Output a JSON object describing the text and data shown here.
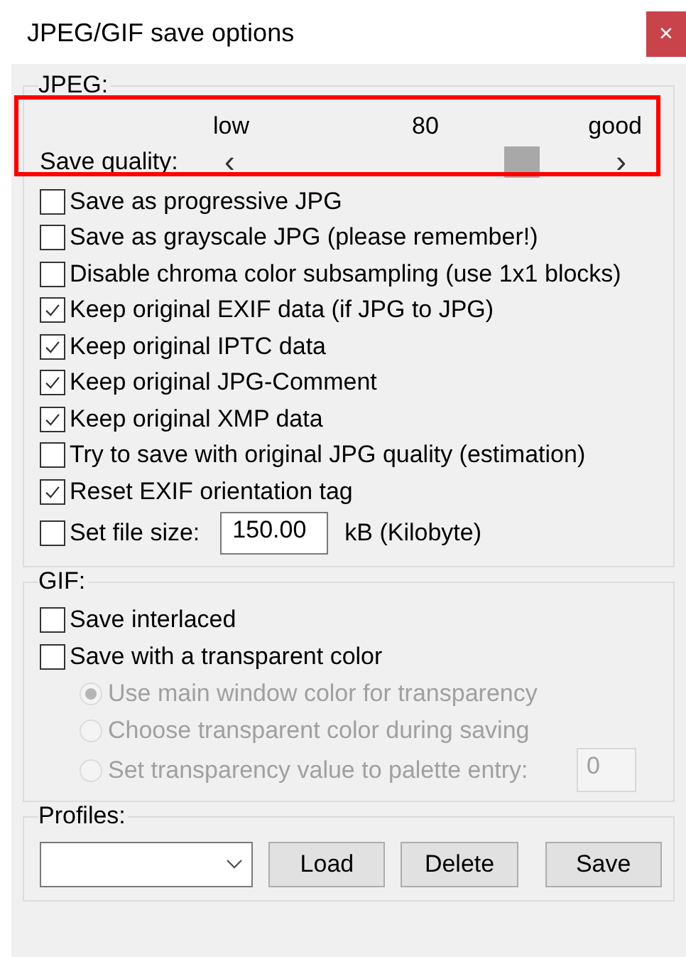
{
  "window": {
    "title": "JPEG/GIF save options",
    "close": "×"
  },
  "jpeg": {
    "title": "JPEG:",
    "highlighted": true,
    "quality": {
      "label": "Save quality:",
      "min_label": "low",
      "value": "80",
      "max_label": "good",
      "level": 0.8,
      "prev": "‹",
      "next": "›"
    },
    "options": [
      {
        "kind": "checkbox",
        "label": "Save as progressive JPG",
        "checked": false
      },
      {
        "kind": "checkbox",
        "label": "Save as grayscale JPG (please remember!)",
        "checked": false
      },
      {
        "kind": "checkbox",
        "label": "Disable chroma color subsampling (use 1x1 blocks)",
        "checked": false
      },
      {
        "kind": "checkbox",
        "label": "Keep original EXIF data (if JPG to JPG)",
        "checked": true
      },
      {
        "kind": "checkbox",
        "label": "Keep original IPTC data",
        "checked": true
      },
      {
        "kind": "checkbox",
        "label": "Keep original JPG-Comment",
        "checked": true
      },
      {
        "kind": "checkbox",
        "label": "Keep original XMP data",
        "checked": true
      },
      {
        "kind": "checkbox",
        "label": "Try to save with original JPG quality (estimation)",
        "checked": false
      },
      {
        "kind": "checkbox",
        "label": "Reset EXIF orientation tag",
        "checked": true
      },
      {
        "kind": "size",
        "label": "Set file size:",
        "checked": false,
        "value": "150.00",
        "unit": "kB (Kilobyte)"
      }
    ]
  },
  "gif": {
    "title": "GIF:",
    "options": [
      {
        "kind": "checkbox",
        "label": "Save interlaced",
        "checked": false
      },
      {
        "kind": "checkbox",
        "label": "Save with a transparent color",
        "checked": false
      },
      {
        "kind": "radio",
        "label": "Use main window color for transparency",
        "selected": true,
        "disabled": true
      },
      {
        "kind": "radio",
        "label": "Choose transparent color during saving",
        "selected": false,
        "disabled": true
      },
      {
        "kind": "radio_field",
        "label": "Set transparency value to palette entry:",
        "selected": false,
        "disabled": true,
        "value": "0"
      }
    ]
  },
  "profiles": {
    "title": "Profiles:",
    "buttons": [
      "Load",
      "Delete",
      "Save"
    ]
  }
}
